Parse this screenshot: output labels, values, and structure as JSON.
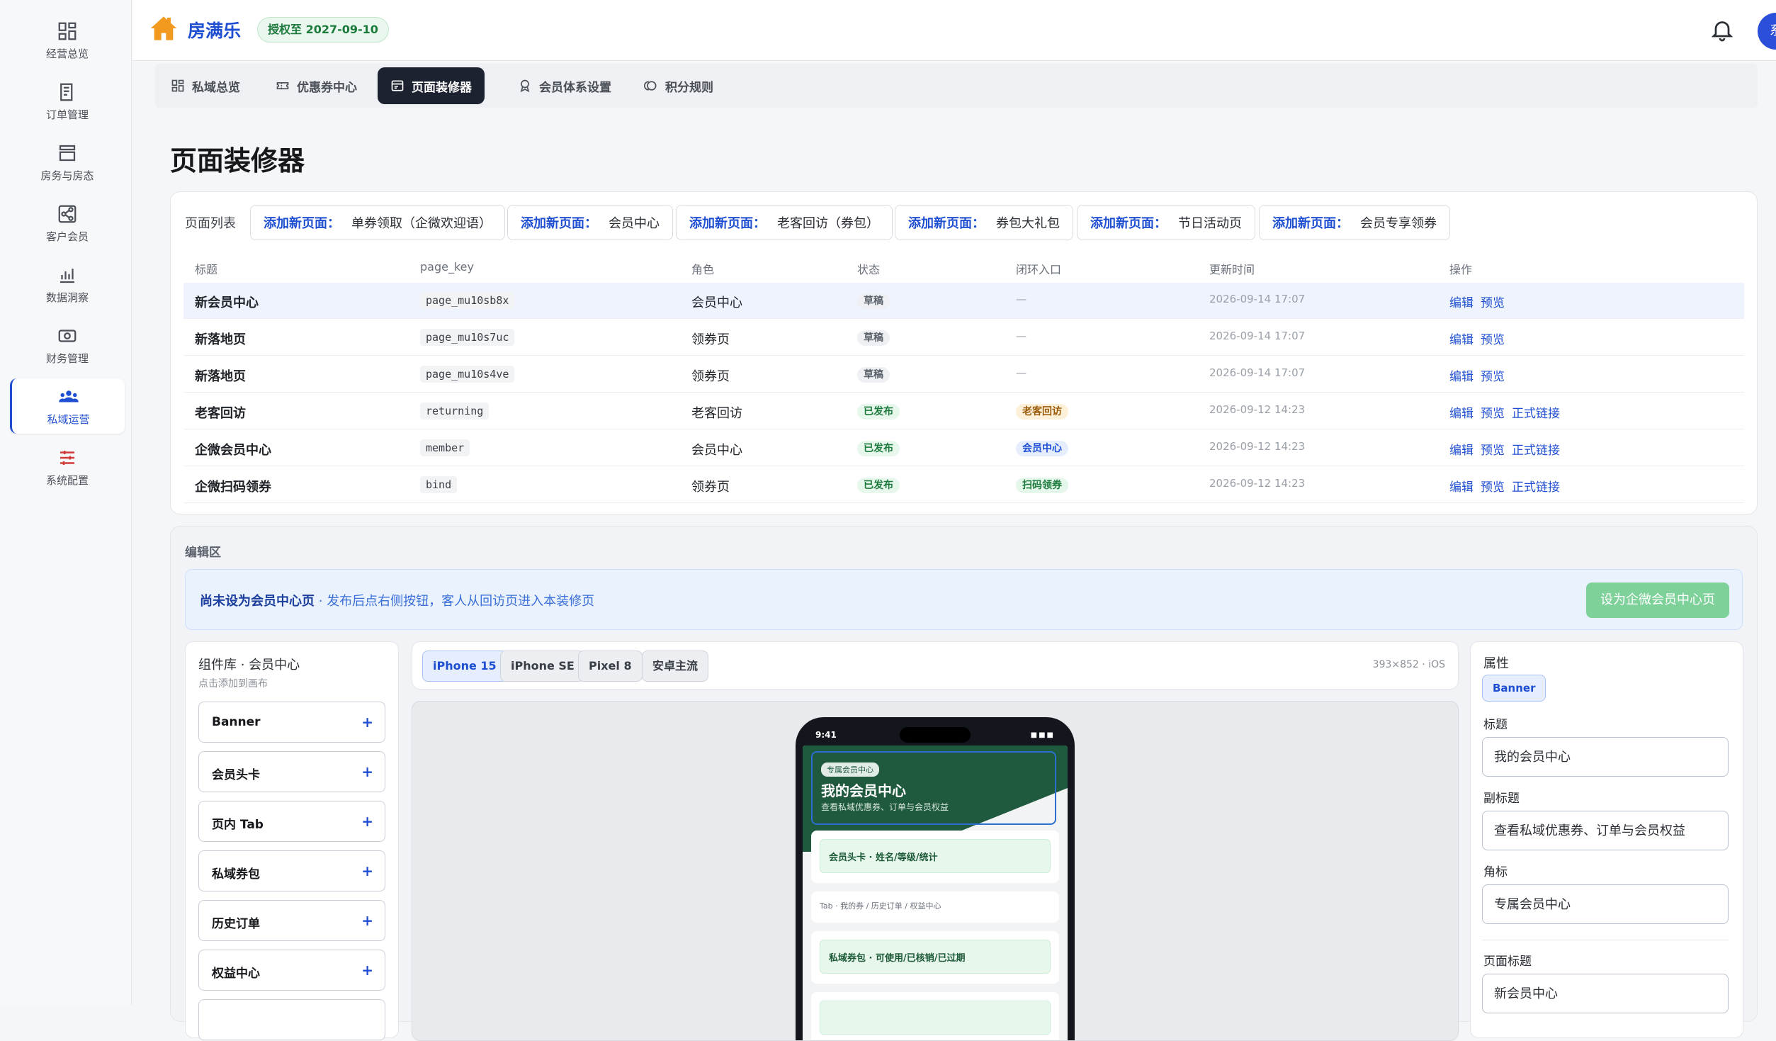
{
  "rail": [
    {
      "label": "经营总览",
      "icon": "dashboard-icon"
    },
    {
      "label": "订单管理",
      "icon": "receipt-icon"
    },
    {
      "label": "房务与房态",
      "icon": "room-icon"
    },
    {
      "label": "客户会员",
      "icon": "share-icon"
    },
    {
      "label": "数据洞察",
      "icon": "chart-icon"
    },
    {
      "label": "财务管理",
      "icon": "money-icon"
    },
    {
      "label": "私域运营",
      "icon": "users-icon",
      "active": true
    },
    {
      "label": "系统配置",
      "icon": "sliders-icon"
    }
  ],
  "topbar": {
    "brand": "房满乐",
    "license": "授权至 2027-09-10",
    "avatar": "系"
  },
  "tabs": [
    {
      "label": "私域总览"
    },
    {
      "label": "优惠券中心"
    },
    {
      "label": "页面装修器",
      "active": true
    },
    {
      "label": "会员体系设置"
    },
    {
      "label": "积分规则"
    }
  ],
  "page_title": "页面装修器",
  "list": {
    "label": "页面列表",
    "add_key": "添加新页面：",
    "add_pages": [
      "单券领取（企微欢迎语）",
      "会员中心",
      "老客回访（券包）",
      "券包大礼包",
      "节日活动页",
      "会员专享领券"
    ],
    "headers": [
      "标题",
      "page_key",
      "角色",
      "状态",
      "闭环入口",
      "更新时间",
      "操作"
    ],
    "rows": [
      {
        "title": "新会员中心",
        "key": "page_mu10sb8x",
        "role": "会员中心",
        "status": "草稿",
        "entry": "—",
        "time": "2026-09-14 17:07",
        "ops": [
          "编辑",
          "预览"
        ]
      },
      {
        "title": "新落地页",
        "key": "page_mu10s7uc",
        "role": "领券页",
        "status": "草稿",
        "entry": "—",
        "time": "2026-09-14 17:07",
        "ops": [
          "编辑",
          "预览"
        ]
      },
      {
        "title": "新落地页",
        "key": "page_mu10s4ve",
        "role": "领券页",
        "status": "草稿",
        "entry": "—",
        "time": "2026-09-14 17:07",
        "ops": [
          "编辑",
          "预览"
        ]
      },
      {
        "title": "老客回访",
        "key": "returning",
        "role": "老客回访",
        "status": "已发布",
        "entry": "老客回访",
        "time": "2026-09-12 14:23",
        "ops": [
          "编辑",
          "预览",
          "正式链接"
        ]
      },
      {
        "title": "企微会员中心",
        "key": "member",
        "role": "会员中心",
        "status": "已发布",
        "entry": "会员中心",
        "time": "2026-09-12 14:23",
        "ops": [
          "编辑",
          "预览",
          "正式链接"
        ]
      },
      {
        "title": "企微扫码领券",
        "key": "bind",
        "role": "领券页",
        "status": "已发布",
        "entry": "扫码领券",
        "time": "2026-09-12 14:23",
        "ops": [
          "编辑",
          "预览",
          "正式链接"
        ]
      }
    ]
  },
  "edit": {
    "label": "编辑区",
    "notice_bold": "尚未设为会员中心页",
    "notice_text": " · 发布后点右侧按钮，客人从回访页进入本装修页",
    "notice_btn": "设为企微会员中心页",
    "lib_title": "组件库 · 会员中心",
    "lib_sub": "点击添加到画布",
    "components": [
      "Banner",
      "会员头卡",
      "页内 Tab",
      "私域券包",
      "历史订单",
      "权益中心"
    ],
    "plus": "+",
    "devices": [
      "iPhone 15",
      "iPhone SE",
      "Pixel 8",
      "安卓主流"
    ],
    "device_info": "393×852 · iOS"
  },
  "phone": {
    "time": "9:41",
    "signal": "■■■",
    "corner": "专属会员中心",
    "title": "我的会员中心",
    "subtitle": "查看私域优惠券、订单与会员权益",
    "card1": "会员头卡 · 姓名/等级/统计",
    "tabline": "Tab · 我的券 / 历史订单 / 权益中心",
    "card2": "私域券包 · 可使用/已核销/已过期"
  },
  "props": {
    "title": "属性",
    "chip": "Banner",
    "f1_label": "标题",
    "f1": "我的会员中心",
    "f2_label": "副标题",
    "f2": "查看私域优惠券、订单与会员权益",
    "f3_label": "角标",
    "f3": "专属会员中心",
    "f4_label": "页面标题",
    "f4": "新会员中心"
  }
}
